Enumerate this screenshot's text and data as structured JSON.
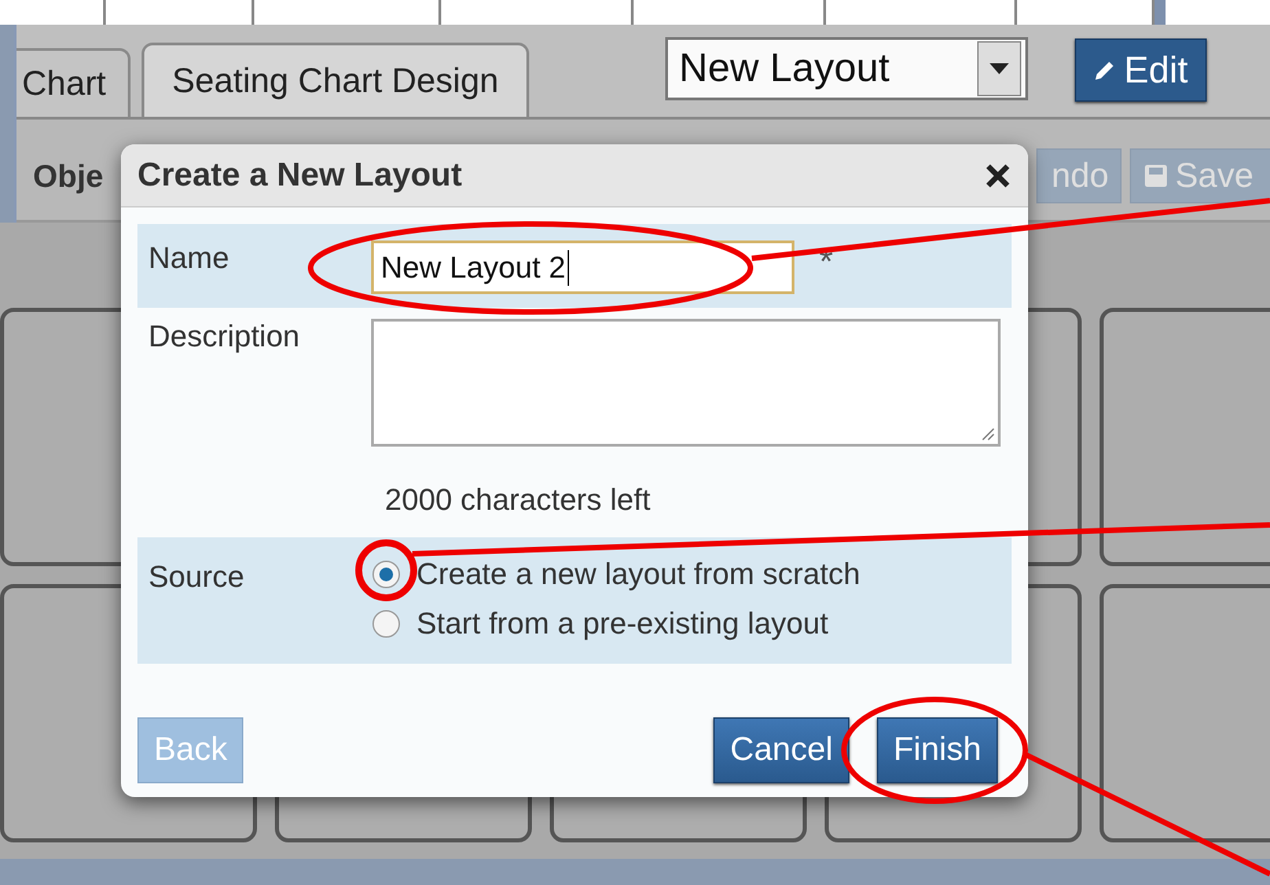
{
  "tabs": [
    {
      "label": "Chart",
      "selected": false
    },
    {
      "label": "Seating Chart Design",
      "selected": true
    }
  ],
  "layout_select": {
    "value": "New Layout"
  },
  "edit_button": {
    "label": "Edit"
  },
  "toolbar": {
    "label": "Obje",
    "buttons": [
      {
        "label": "ndo",
        "disabled": true
      },
      {
        "label": "Save",
        "disabled": true
      }
    ]
  },
  "dialog": {
    "title": "Create a New Layout",
    "name": {
      "label": "Name",
      "value": "New Layout 2",
      "required_mark": "*"
    },
    "description": {
      "label": "Description",
      "counter": "2000 characters left"
    },
    "source": {
      "label": "Source",
      "options": [
        {
          "label": "Create a new layout from scratch",
          "selected": true
        },
        {
          "label": "Start from a pre-existing layout",
          "selected": false
        }
      ]
    },
    "buttons": [
      {
        "label": "Back",
        "disabled": true
      },
      {
        "label": "Cancel",
        "disabled": false
      },
      {
        "label": "Finish",
        "disabled": false
      }
    ]
  }
}
